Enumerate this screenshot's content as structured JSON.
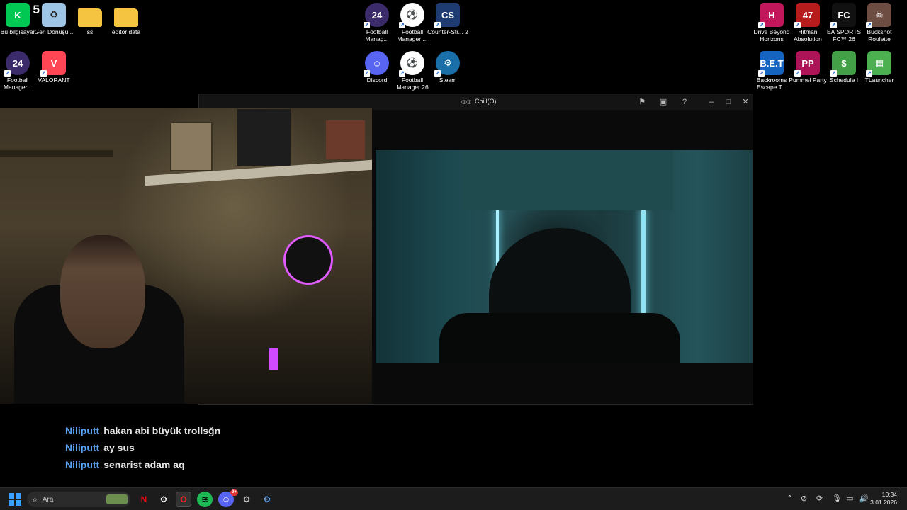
{
  "desktop_left": [
    {
      "label": "Bu bilgisayar",
      "icon": "k5-icon",
      "glyph": "K",
      "color": "#00c853"
    },
    {
      "label": "Geri Dönüşü...",
      "icon": "recycle-bin-icon",
      "glyph": "♻",
      "color": "#9ec5e6"
    },
    {
      "label": "ss",
      "icon": "folder-icon",
      "glyph": "",
      "color": "#f5c542"
    },
    {
      "label": "editor data",
      "icon": "folder-icon",
      "glyph": "",
      "color": "#f5c542"
    },
    {
      "label": "Football Manager...",
      "icon": "fm24-icon",
      "glyph": "24",
      "color": "#3b2b6b"
    },
    {
      "label": "VALORANT",
      "icon": "valorant-icon",
      "glyph": "V",
      "color": "#ff4655"
    }
  ],
  "k5_badge": "5",
  "desktop_center": [
    {
      "label": "Football Manag...",
      "icon": "fm24-icon",
      "glyph": "24",
      "color": "#3b2b6b"
    },
    {
      "label": "Football Manager ...",
      "icon": "football-manager-icon",
      "glyph": "⚽",
      "color": "#ffffff"
    },
    {
      "label": "Counter-Str... 2",
      "icon": "cs2-icon",
      "glyph": "CS",
      "color": "#1e3c72"
    },
    {
      "label": "Discord",
      "icon": "discord-icon",
      "glyph": "☺",
      "color": "#5865f2"
    },
    {
      "label": "Football Manager 26",
      "icon": "football-manager-icon",
      "glyph": "⚽",
      "color": "#ffffff"
    },
    {
      "label": "Steam",
      "icon": "steam-icon",
      "glyph": "⚙",
      "color": "#1b6fa8"
    }
  ],
  "desktop_right": [
    {
      "label": "Drive Beyond Horizons",
      "icon": "drive-beyond-icon",
      "glyph": "H",
      "color": "#c2185b"
    },
    {
      "label": "Hitman Absolution",
      "icon": "hitman-icon",
      "glyph": "47",
      "color": "#b71c1c"
    },
    {
      "label": "EA SPORTS FC™ 26",
      "icon": "ea-fc-icon",
      "glyph": "FC",
      "color": "#111111"
    },
    {
      "label": "Buckshot Roulette",
      "icon": "buckshot-icon",
      "glyph": "☠",
      "color": "#6d4c41"
    },
    {
      "label": "Backrooms Escape T...",
      "icon": "backrooms-icon",
      "glyph": "B.E.T",
      "color": "#1565c0"
    },
    {
      "label": "Pummel Party",
      "icon": "pummel-party-icon",
      "glyph": "PP",
      "color": "#ad1457"
    },
    {
      "label": "Schedule I",
      "icon": "schedule-i-icon",
      "glyph": "$",
      "color": "#43a047"
    },
    {
      "label": "TLauncher",
      "icon": "tlauncher-icon",
      "glyph": "▦",
      "color": "#4caf50"
    }
  ],
  "chill_window": {
    "title": "Chill(O)"
  },
  "chat": [
    {
      "user": "Niliputt",
      "message": "hakan abi büyük trollsğn"
    },
    {
      "user": "Niliputt",
      "message": "ay sus"
    },
    {
      "user": "Niliputt",
      "message": "senarist adam aq"
    }
  ],
  "taskbar": {
    "search_placeholder": "Ara",
    "discord_badge": "9+",
    "time": "10:34",
    "date": "3.01.2026"
  }
}
